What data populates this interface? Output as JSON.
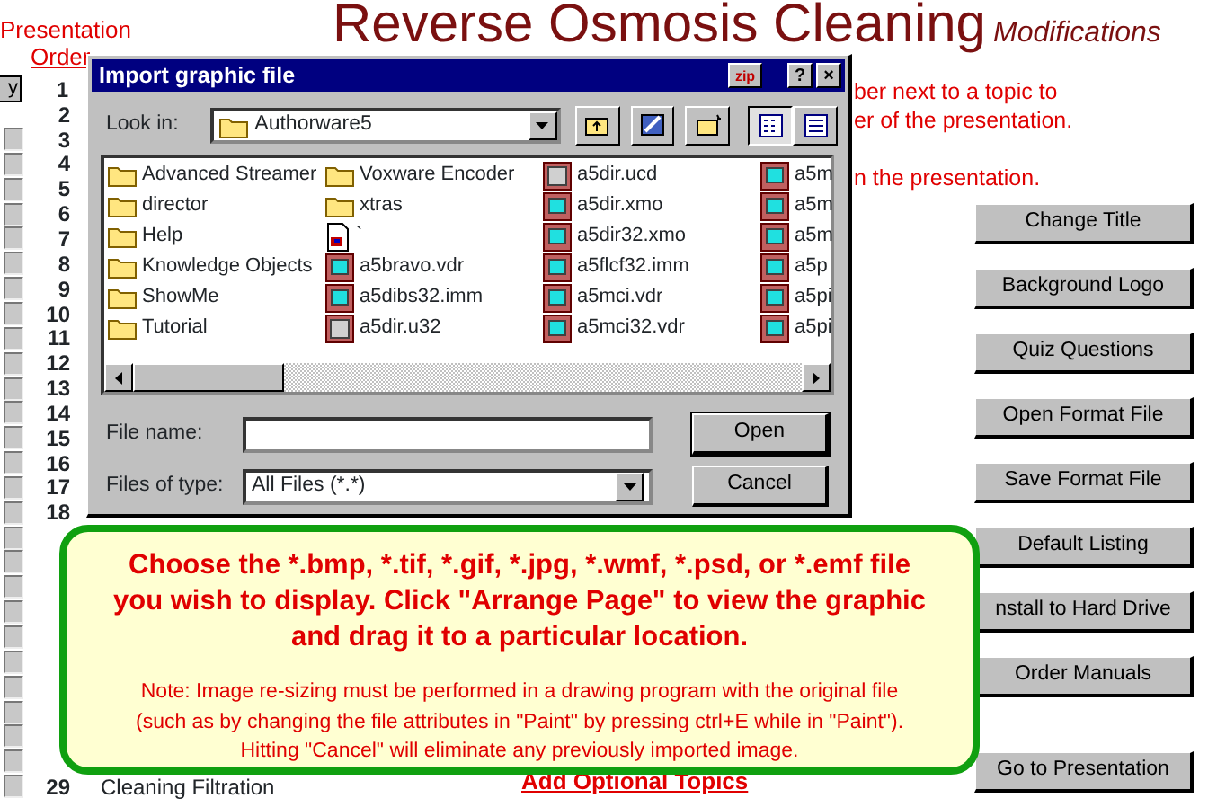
{
  "header": {
    "title": "Reverse Osmosis Cleaning",
    "subtitle": "Modifications"
  },
  "left": {
    "heading": "Presentation",
    "link": "Order",
    "button": "y"
  },
  "rows": [
    {
      "number": "1",
      "kind": "plain"
    },
    {
      "number": "2",
      "kind": "plain"
    },
    {
      "number": "3",
      "kind": "check",
      "checked": false
    },
    {
      "number": "4",
      "kind": "check",
      "checked": false
    },
    {
      "number": "5",
      "kind": "check",
      "checked": false
    },
    {
      "number": "6",
      "kind": "check",
      "checked": false
    },
    {
      "number": "7",
      "kind": "check",
      "checked": false
    },
    {
      "number": "8",
      "kind": "check",
      "checked": false
    },
    {
      "number": "9",
      "kind": "check",
      "checked": false
    },
    {
      "number": "10",
      "kind": "check",
      "checked": false
    },
    {
      "number": "11",
      "kind": "check",
      "checked": false
    },
    {
      "number": "12",
      "kind": "check",
      "checked": false
    },
    {
      "number": "13",
      "kind": "check",
      "checked": false
    },
    {
      "number": "14",
      "kind": "check",
      "checked": false
    },
    {
      "number": "15",
      "kind": "check",
      "checked": false
    },
    {
      "number": "16",
      "kind": "check",
      "checked": false
    },
    {
      "number": "17",
      "kind": "check",
      "checked": false
    },
    {
      "number": "18",
      "kind": "check",
      "checked": false
    },
    {
      "kind": "check",
      "checked": false
    },
    {
      "kind": "check",
      "checked": false
    },
    {
      "kind": "check",
      "checked": false
    },
    {
      "kind": "check",
      "checked": false
    },
    {
      "kind": "check",
      "checked": false
    },
    {
      "kind": "check",
      "checked": false
    },
    {
      "kind": "check",
      "checked": false
    },
    {
      "kind": "check",
      "checked": false
    },
    {
      "kind": "check",
      "checked": false
    },
    {
      "kind": "check",
      "checked": false
    },
    {
      "number": "29",
      "kind": "check",
      "checked": false,
      "topic": "Cleaning Filtration"
    }
  ],
  "instructions": [
    [
      "ber next to a topic to",
      "er of the presentation."
    ],
    [
      "n the presentation."
    ]
  ],
  "buttons": [
    "Change Title",
    "Background Logo",
    "Quiz Questions",
    "Open Format File",
    "Save Format File",
    "Default Listing",
    "nstall to Hard Drive",
    "Order Manuals",
    "Go to Presentation"
  ],
  "optional_heading": "Add Optional Topics",
  "dialog": {
    "title": "Import graphic file",
    "zip": "zip",
    "help": "?",
    "close": "×",
    "look_in_label": "Look in:",
    "look_in_value": "Authorware5",
    "files": [
      {
        "name": "Advanced Streamer",
        "kind": "folder"
      },
      {
        "name": "director",
        "kind": "folder"
      },
      {
        "name": "Help",
        "kind": "folder"
      },
      {
        "name": "Knowledge Objects",
        "kind": "folder"
      },
      {
        "name": "ShowMe",
        "kind": "folder"
      },
      {
        "name": "Tutorial",
        "kind": "folder"
      },
      {
        "name": "Voxware Encoder",
        "kind": "folder"
      },
      {
        "name": "xtras",
        "kind": "folder"
      },
      {
        "name": "`",
        "kind": "document"
      },
      {
        "name": "a5bravo.vdr",
        "kind": "app"
      },
      {
        "name": "a5dibs32.imm",
        "kind": "app"
      },
      {
        "name": "a5dir.u32",
        "kind": "library"
      },
      {
        "name": "a5dir.ucd",
        "kind": "library"
      },
      {
        "name": "a5dir.xmo",
        "kind": "app"
      },
      {
        "name": "a5dir32.xmo",
        "kind": "app"
      },
      {
        "name": "a5flcf32.imm",
        "kind": "app"
      },
      {
        "name": "a5mci.vdr",
        "kind": "app"
      },
      {
        "name": "a5mci32.vdr",
        "kind": "app"
      },
      {
        "name": "a5m",
        "kind": "app"
      },
      {
        "name": "a5m",
        "kind": "app"
      },
      {
        "name": "a5m",
        "kind": "app"
      },
      {
        "name": "a5p",
        "kind": "app"
      },
      {
        "name": "a5pi",
        "kind": "app"
      },
      {
        "name": "a5pi",
        "kind": "app"
      }
    ],
    "file_name_label": "File name:",
    "type_label": "Files of type:",
    "type_value": "All Files (*.*)",
    "open": "Open",
    "cancel": "Cancel"
  },
  "callout": {
    "main_lines": [
      "Choose the *.bmp, *.tif, *.gif, *.jpg, *.wmf, *.psd, or *.emf  file",
      "you wish to display.  Click \"Arrange Page\" to view the graphic",
      "and drag it to a particular location."
    ],
    "note_lines": [
      "Note: Image re-sizing must be performed in a drawing program with the original file",
      "(such as by changing the file attributes in \"Paint\" by pressing ctrl+E while in \"Paint\").",
      "Hitting \"Cancel\" will eliminate any previously imported image."
    ]
  }
}
